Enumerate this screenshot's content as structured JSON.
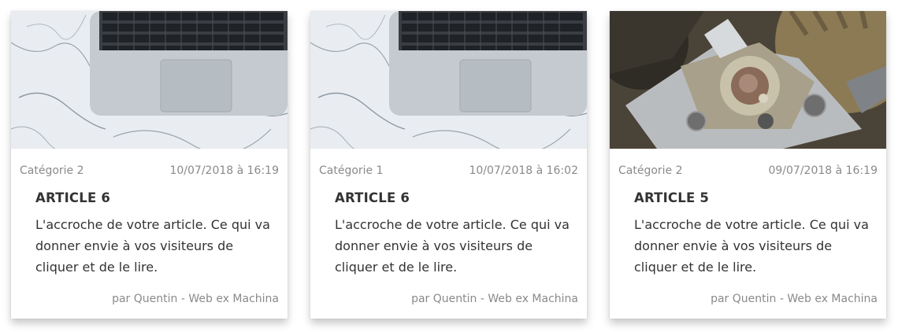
{
  "cards": [
    {
      "image": "laptop-on-marble-image",
      "category": "Catégorie 2",
      "date": "10/07/2018 à 16:19",
      "title": "ARTICLE 6",
      "excerpt": "L'accroche de votre article. Ce qui va donner envie à vos visiteurs de cliquer et de le lire.",
      "author": "par Quentin - Web ex Machina"
    },
    {
      "image": "laptop-on-marble-image",
      "category": "Catégorie 1",
      "date": "10/07/2018 à 16:02",
      "title": "ARTICLE 6",
      "excerpt": "L'accroche de votre article. Ce qui va donner envie à vos visiteurs de cliquer et de le lire.",
      "author": "par Quentin - Web ex Machina"
    },
    {
      "image": "watch-mechanism-gears-image",
      "category": "Catégorie 2",
      "date": "09/07/2018 à 16:19",
      "title": "ARTICLE 5",
      "excerpt": "L'accroche de votre article. Ce qui va donner envie à vos visiteurs de cliquer et de le lire.",
      "author": "par Quentin - Web ex Machina"
    }
  ]
}
